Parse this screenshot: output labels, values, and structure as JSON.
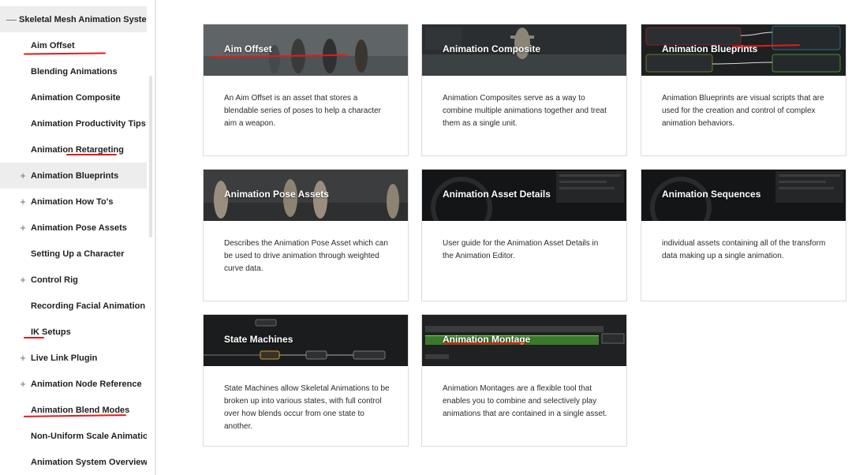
{
  "sidebar": {
    "root": {
      "label": "Skeletal Mesh Animation System",
      "toggle": "—"
    },
    "items": [
      {
        "label": "Aim Offset",
        "toggle": ""
      },
      {
        "label": "Blending Animations",
        "toggle": ""
      },
      {
        "label": "Animation Composite",
        "toggle": ""
      },
      {
        "label": "Animation Productivity Tips ...",
        "toggle": ""
      },
      {
        "label": "Animation Retargeting",
        "toggle": ""
      },
      {
        "label": "Animation Blueprints",
        "toggle": "+"
      },
      {
        "label": "Animation How To's",
        "toggle": "+"
      },
      {
        "label": "Animation Pose Assets",
        "toggle": "+"
      },
      {
        "label": "Setting Up a Character",
        "toggle": ""
      },
      {
        "label": "Control Rig",
        "toggle": "+"
      },
      {
        "label": "Recording Facial Animation ...",
        "toggle": ""
      },
      {
        "label": "IK Setups",
        "toggle": ""
      },
      {
        "label": "Live Link Plugin",
        "toggle": "+"
      },
      {
        "label": "Animation Node Reference",
        "toggle": "+"
      },
      {
        "label": "Animation Blend Modes",
        "toggle": ""
      },
      {
        "label": "Non-Uniform Scale Animation",
        "toggle": ""
      },
      {
        "label": "Animation System Overview",
        "toggle": ""
      }
    ]
  },
  "cards": [
    {
      "title": "Aim Offset",
      "description": "An Aim Offset is an asset that stores a blendable series of poses to help a character aim a weapon.",
      "thumb": "characters-gray"
    },
    {
      "title": "Animation Composite",
      "description": "Animation Composites serve as a way to combine multiple animations together and treat them as a single unit.",
      "thumb": "viewport-dark"
    },
    {
      "title": "Animation Blueprints",
      "description": "Animation Blueprints are visual scripts that are used for the creation and control of complex animation behaviors.",
      "thumb": "blueprint-graph"
    },
    {
      "title": "Animation Pose Assets",
      "description": "Describes the Animation Pose Asset which can be used to drive animation through weighted curve data.",
      "thumb": "mannequins"
    },
    {
      "title": "Animation Asset Details",
      "description": "User guide for the Animation Asset Details in the Animation Editor.",
      "thumb": "ue-logo"
    },
    {
      "title": "Animation Sequences",
      "description": "individual assets containing all of the transform data making up a single animation.",
      "thumb": "ue-logo"
    },
    {
      "title": "State Machines",
      "description": "State Machines allow Skeletal Animations to be broken up into various states, with full control over how blends occur from one state to another.",
      "thumb": "state-graph"
    },
    {
      "title": "Animation Montage",
      "description": "Animation Montages are a flexible tool that enables you to combine and selectively play animations that are contained in a single asset.",
      "thumb": "montage-timeline"
    }
  ],
  "colors": {
    "annotation": "#e31b1b",
    "sidebar_highlight": "#ededed",
    "card_border": "#dcdcdc"
  }
}
